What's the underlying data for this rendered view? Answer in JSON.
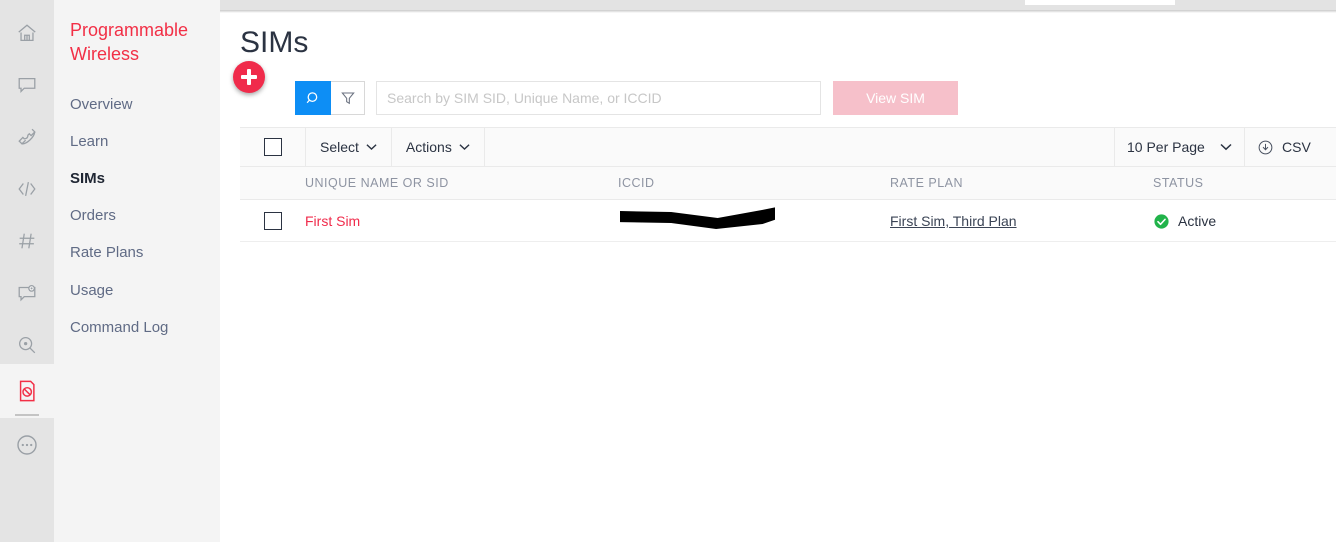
{
  "window": {
    "top_strip_color": "#e3e3e3"
  },
  "icon_rail": {
    "items": [
      {
        "name": "home-icon",
        "label": "Home"
      },
      {
        "name": "chat-icon",
        "label": "Chat"
      },
      {
        "name": "phone-icon",
        "label": "Phone"
      },
      {
        "name": "code-icon",
        "label": "Code"
      },
      {
        "name": "hash-icon",
        "label": "Numbers"
      },
      {
        "name": "chat-dot-icon",
        "label": "Messaging"
      },
      {
        "name": "search-circle-icon",
        "label": "Lookup"
      },
      {
        "name": "sim-card-icon",
        "label": "Programmable Wireless"
      },
      {
        "name": "more-icon",
        "label": "More"
      }
    ],
    "active_index": 7,
    "active_color": "#f22f46"
  },
  "sidebar": {
    "title": "Programmable Wireless",
    "brand_color": "#f22f46",
    "items": [
      {
        "label": "Overview"
      },
      {
        "label": "Learn"
      },
      {
        "label": "SIMs"
      },
      {
        "label": "Orders"
      },
      {
        "label": "Rate Plans"
      },
      {
        "label": "Usage"
      },
      {
        "label": "Command Log"
      }
    ],
    "selected": "SIMs"
  },
  "page": {
    "title": "SIMs"
  },
  "fab": {
    "name": "add-button",
    "label": "+",
    "color": "#f02b4b"
  },
  "toolbar": {
    "search_button_icon": "search-icon",
    "search_button_color": "#0d8ef5",
    "filter_button_icon": "filter-icon",
    "search_placeholder": "Search by SIM SID, Unique Name, or ICCID",
    "search_value": "",
    "view_sim_label": "View SIM",
    "view_sim_color": "#f6c0ca"
  },
  "table_actions": {
    "select_label": "Select",
    "actions_label": "Actions",
    "per_page_label": "10 Per Page",
    "csv_label": "CSV",
    "csv_icon": "download-circle-icon"
  },
  "table": {
    "columns": [
      {
        "key": "unique_name",
        "label": "UNIQUE NAME OR SID"
      },
      {
        "key": "iccid",
        "label": "ICCID"
      },
      {
        "key": "rate_plan",
        "label": "RATE PLAN"
      },
      {
        "key": "status",
        "label": "STATUS"
      }
    ],
    "rows": [
      {
        "unique_name": "First Sim",
        "iccid": "",
        "iccid_redacted": true,
        "rate_plan": "First Sim, Third Plan",
        "status": "Active",
        "status_color": "#21b34a"
      }
    ]
  }
}
